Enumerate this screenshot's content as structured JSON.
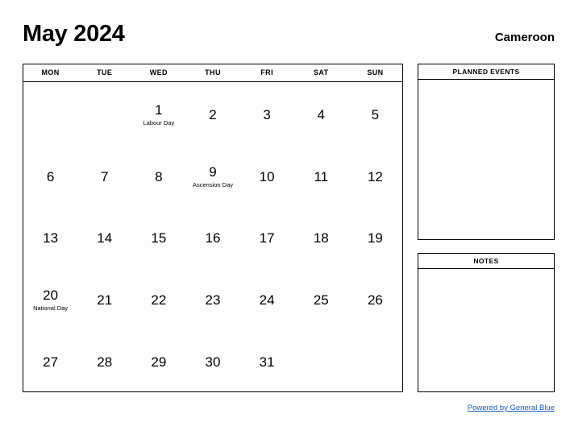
{
  "header": {
    "title": "May 2024",
    "country": "Cameroon"
  },
  "calendar": {
    "weekdays": [
      "MON",
      "TUE",
      "WED",
      "THU",
      "FRI",
      "SAT",
      "SUN"
    ],
    "weeks": [
      [
        {
          "day": "",
          "event": ""
        },
        {
          "day": "",
          "event": ""
        },
        {
          "day": "1",
          "event": "Labour Day"
        },
        {
          "day": "2",
          "event": ""
        },
        {
          "day": "3",
          "event": ""
        },
        {
          "day": "4",
          "event": ""
        },
        {
          "day": "5",
          "event": ""
        }
      ],
      [
        {
          "day": "6",
          "event": ""
        },
        {
          "day": "7",
          "event": ""
        },
        {
          "day": "8",
          "event": ""
        },
        {
          "day": "9",
          "event": "Ascension Day"
        },
        {
          "day": "10",
          "event": ""
        },
        {
          "day": "11",
          "event": ""
        },
        {
          "day": "12",
          "event": ""
        }
      ],
      [
        {
          "day": "13",
          "event": ""
        },
        {
          "day": "14",
          "event": ""
        },
        {
          "day": "15",
          "event": ""
        },
        {
          "day": "16",
          "event": ""
        },
        {
          "day": "17",
          "event": ""
        },
        {
          "day": "18",
          "event": ""
        },
        {
          "day": "19",
          "event": ""
        }
      ],
      [
        {
          "day": "20",
          "event": "National Day"
        },
        {
          "day": "21",
          "event": ""
        },
        {
          "day": "22",
          "event": ""
        },
        {
          "day": "23",
          "event": ""
        },
        {
          "day": "24",
          "event": ""
        },
        {
          "day": "25",
          "event": ""
        },
        {
          "day": "26",
          "event": ""
        }
      ],
      [
        {
          "day": "27",
          "event": ""
        },
        {
          "day": "28",
          "event": ""
        },
        {
          "day": "29",
          "event": ""
        },
        {
          "day": "30",
          "event": ""
        },
        {
          "day": "31",
          "event": ""
        },
        {
          "day": "",
          "event": ""
        },
        {
          "day": "",
          "event": ""
        }
      ]
    ]
  },
  "panels": {
    "planned_events": {
      "title": "PLANNED EVENTS",
      "content": ""
    },
    "notes": {
      "title": "NOTES",
      "content": ""
    }
  },
  "footer": {
    "link_label": "Powered by General Blue",
    "link_color": "#1a5ac4"
  }
}
